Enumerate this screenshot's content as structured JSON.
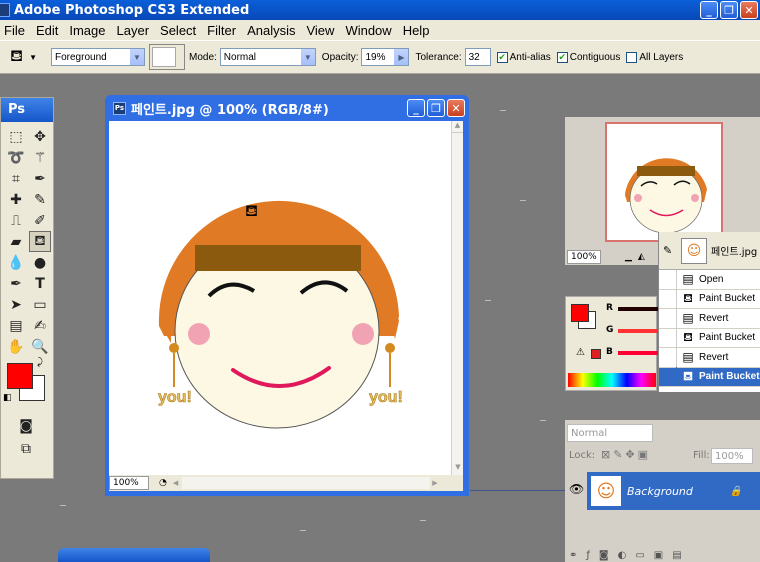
{
  "app": {
    "title": "Adobe Photoshop CS3 Extended",
    "window_buttons": [
      "_",
      "❐",
      "✕"
    ]
  },
  "menu": [
    "File",
    "Edit",
    "Image",
    "Layer",
    "Select",
    "Filter",
    "Analysis",
    "View",
    "Window",
    "Help"
  ],
  "options": {
    "fill_source": "Foreground",
    "mode_label": "Mode:",
    "mode_value": "Normal",
    "opacity_label": "Opacity:",
    "opacity_value": "19%",
    "tolerance_label": "Tolerance:",
    "tolerance_value": "32",
    "anti_alias": "Anti-alias",
    "contiguous": "Contiguous",
    "all_layers": "All Layers"
  },
  "toolbox": {
    "logo": "Ps",
    "foreground_color": "#ff0000",
    "background_color": "#ffffff"
  },
  "document": {
    "title": "페인트.jpg @ 100% (RGB/8#)",
    "zoom": "100%",
    "earring_text": "you!"
  },
  "navigator": {
    "zoom": "100%"
  },
  "history": {
    "snapshot_name": "페인트.jpg",
    "items": [
      "Open",
      "Paint Bucket",
      "Revert",
      "Paint Bucket",
      "Revert",
      "Paint Bucket"
    ],
    "active_index": 5
  },
  "color_panel": {
    "channels": [
      "R",
      "G",
      "B"
    ],
    "swatch": "#ff0000"
  },
  "layers": {
    "blend_mode": "Normal",
    "lock_label": "Lock:",
    "fill_label": "Fill:",
    "fill_value": "100%",
    "layer_name": "Background"
  },
  "colors": {
    "hair": "#e07a24",
    "bangs": "#8b5a0e",
    "skin": "#fdf8e3",
    "cheek": "#f2a3b3",
    "smile": "#e0185c",
    "accent": "#316ac5"
  }
}
